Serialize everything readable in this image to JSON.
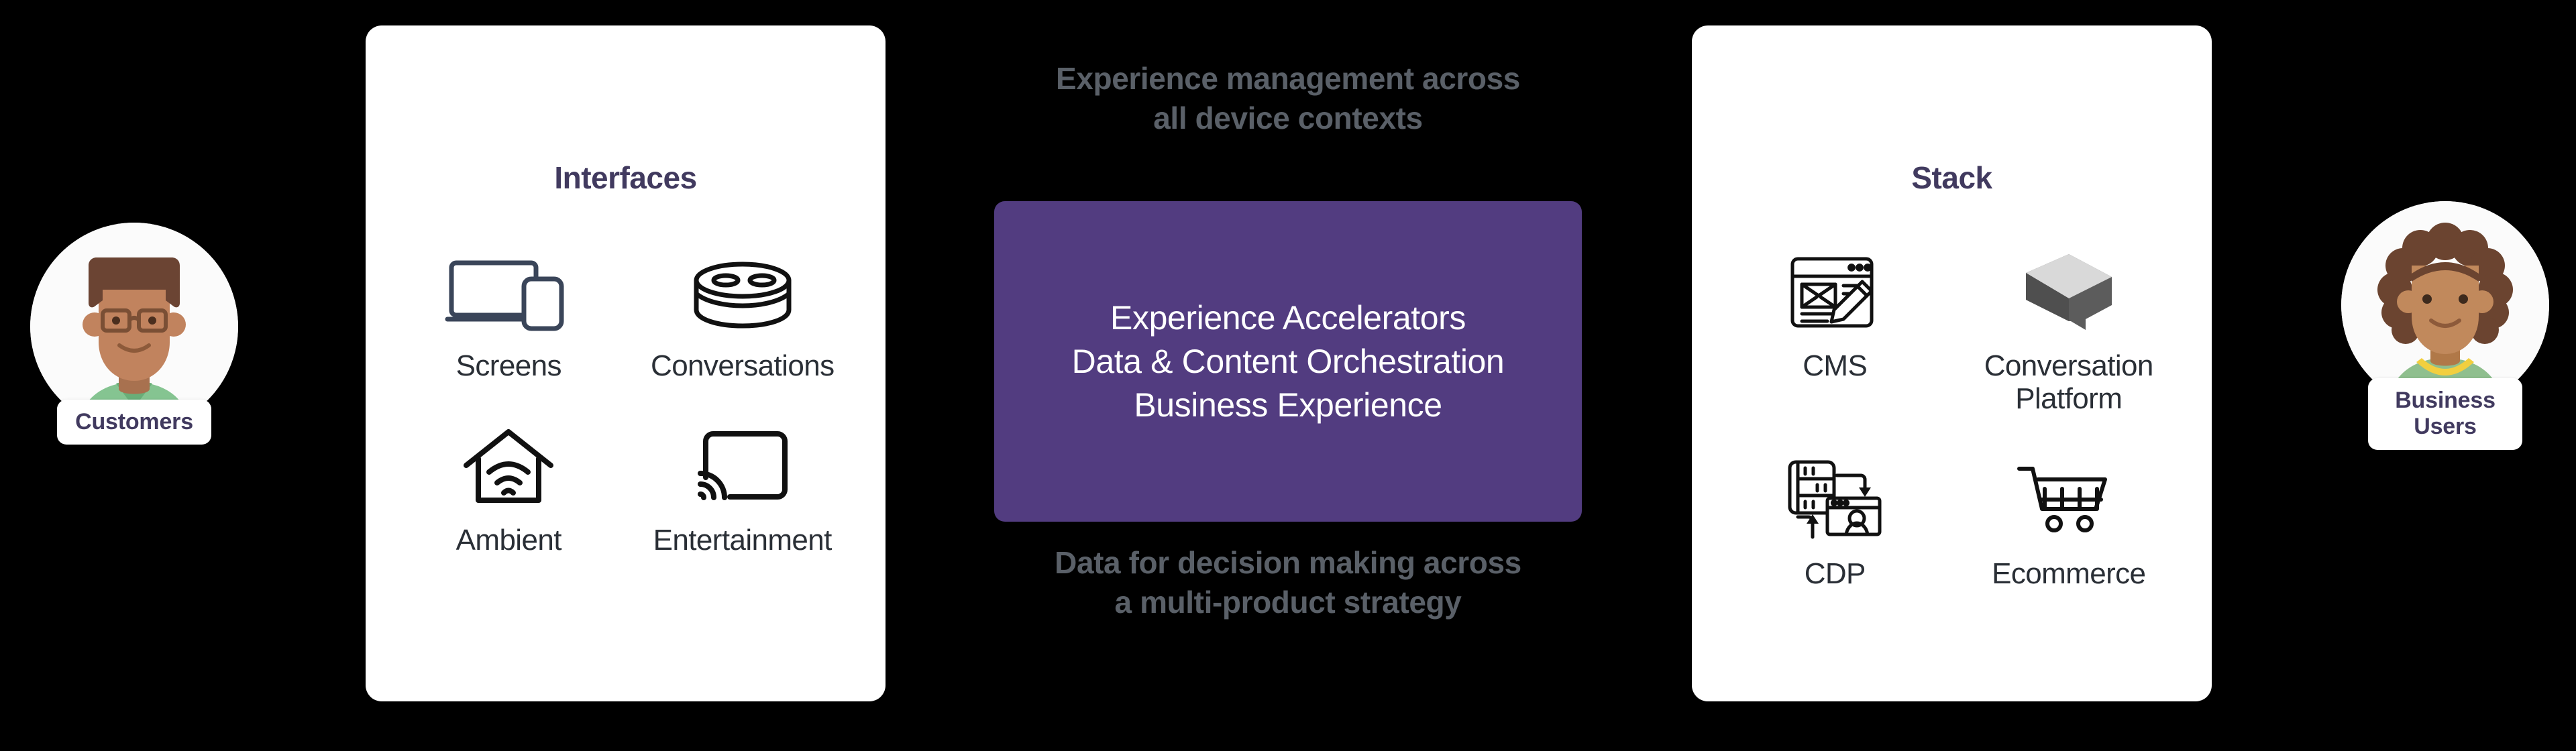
{
  "personas": [
    {
      "id": "customers",
      "label": "Customers",
      "avatar": "man-with-glasses-avatar"
    },
    {
      "id": "business",
      "label": "Business\nUsers",
      "label_line1": "Business",
      "label_line2": "Users",
      "avatar": "woman-curly-hair-avatar"
    }
  ],
  "interfaces_card": {
    "title": "Interfaces",
    "tiles": [
      {
        "label": "Screens",
        "icon": "laptop-and-phone-icon"
      },
      {
        "label": "Conversations",
        "icon": "smart-speaker-icon"
      },
      {
        "label": "Ambient",
        "icon": "house-wifi-icon"
      },
      {
        "label": "Entertainment",
        "icon": "screen-cast-icon"
      }
    ]
  },
  "stack_card": {
    "title": "Stack",
    "tiles": [
      {
        "label": "CMS",
        "icon": "cms-browser-pencil-icon"
      },
      {
        "label": "Conversation\nPlatform",
        "label_line1": "Conversation",
        "label_line2": "Platform",
        "icon": "isometric-speech-bubble-icon"
      },
      {
        "label": "CDP",
        "icon": "server-to-profile-sync-icon"
      },
      {
        "label": "Ecommerce",
        "icon": "shopping-cart-icon"
      }
    ]
  },
  "center": {
    "caption_top_line1": "Experience management across",
    "caption_top_line2": "all device contexts",
    "caption_bottom_line1": "Data for decision making across",
    "caption_bottom_line2": "a multi-product strategy",
    "box_line1": "Experience Accelerators",
    "box_line2": "Data & Content Orchestration",
    "box_line3": "Business Experience"
  },
  "colors": {
    "background": "#000000",
    "card": "#ffffff",
    "accent_purple": "#523C80",
    "title_indigo": "#413a5f",
    "caption_grey": "#5a6068",
    "label_dark": "#2a2f36",
    "device_slate": "#3a4559"
  }
}
